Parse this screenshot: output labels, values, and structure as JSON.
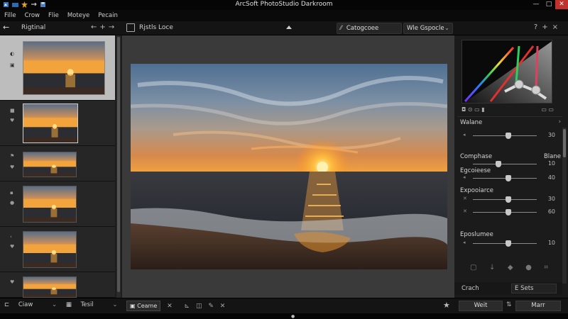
{
  "window": {
    "title": "ArcSoft PhotoStudio Darkroom",
    "controls": {
      "minimize": "—",
      "maximize": "□",
      "close": "✕"
    }
  },
  "menu": [
    "Fille",
    "Crow",
    "Flie",
    "Moteye",
    "Pecain"
  ],
  "toolbar": {
    "left_label": "Rigtinal",
    "left_tools": "←+→",
    "mid_label": "Rjstls Loce",
    "category_button": "Catogcoee",
    "select_button": "Wle Gspocle",
    "right_tools": "?+×"
  },
  "curves": {
    "icons_left": "◘ ⊙ ▭ ▮",
    "icons_right": "▭ ▭"
  },
  "adjustments": {
    "section1": {
      "label": "Walane",
      "value": "30",
      "knob_pct": 0.55
    },
    "section2": {
      "label": "Comphase",
      "label_right": "Blane",
      "sliders": [
        {
          "label": "",
          "value": "10",
          "knob_pct": 0.4
        },
        {
          "label": "Egcoieese",
          "value": "40",
          "knob_pct": 0.55
        }
      ]
    },
    "section3": {
      "label": "Expooiarce",
      "sliders": [
        {
          "value": "30",
          "knob_pct": 0.55
        },
        {
          "value": "60",
          "knob_pct": 0.55
        }
      ]
    },
    "section4": {
      "label": "Eposlumee",
      "value": "10",
      "knob_pct": 0.55
    }
  },
  "right_footer": {
    "left": "Crach",
    "right": "E Sets"
  },
  "bottom": {
    "left_a": "Ciaw",
    "left_b": "Tesil",
    "tab": "Ceame",
    "btn_w": "Weit",
    "btn_m": "Marr"
  },
  "filmstrip": {
    "count": 6,
    "selected_index": 0
  }
}
